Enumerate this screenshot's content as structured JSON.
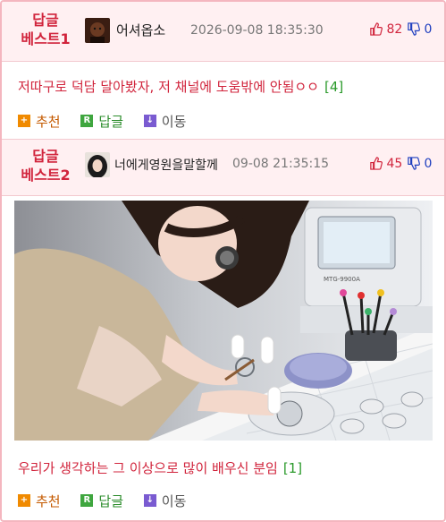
{
  "post1": {
    "best_label": "답글",
    "best_rank": "베스트1",
    "nickname": "어셔옵소",
    "datetime": "2026-09-08 18:35:30",
    "upvotes": "82",
    "downvotes": "0",
    "title": "저따구로 덕담 달아봤자, 저 채널에 도움밖에 안됨ㅇㅇ",
    "reply_count": "[4]",
    "actions": {
      "recommend": "추천",
      "reply": "답글",
      "move": "이동"
    }
  },
  "post2": {
    "best_label": "답글",
    "best_rank": "베스트2",
    "nickname": "너에게영원을말할께",
    "datetime": "09-08 21:35:15",
    "upvotes": "45",
    "downvotes": "0",
    "title": "우리가 생각하는 그 이상으로 많이 배우신 분임",
    "reply_count": "[1]",
    "actions": {
      "recommend": "추천",
      "reply": "답글",
      "move": "이동"
    },
    "image_text": "MTG-9900A"
  },
  "colors": {
    "accent": "#d1243c",
    "border": "#f4b6bf",
    "header_bg": "#fff0f2",
    "green": "#2b9a2b",
    "blue": "#1f3fbf"
  }
}
